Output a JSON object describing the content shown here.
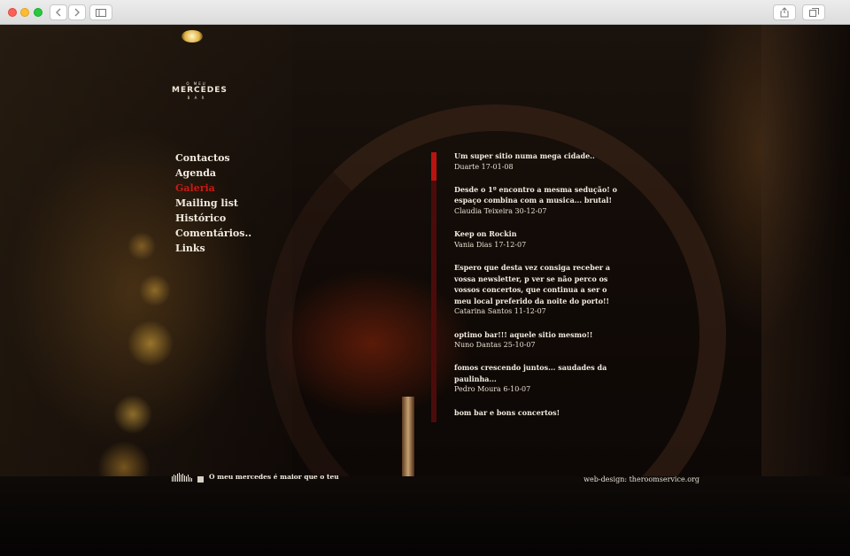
{
  "logo": {
    "top": "O MEU",
    "name": "MERCEDES",
    "sub": "B A R"
  },
  "nav": {
    "items": [
      {
        "label": "Contactos"
      },
      {
        "label": "Agenda"
      },
      {
        "label": "Galeria"
      },
      {
        "label": "Mailing list"
      },
      {
        "label": "Histórico"
      },
      {
        "label": "Comentários.."
      },
      {
        "label": "Links"
      }
    ],
    "active_index": 2,
    "active_color": "#c81a14"
  },
  "comments": [
    {
      "message": "Um super sitio numa mega cidade..",
      "author": "Duarte 17-01-08"
    },
    {
      "message": "Desde o 1º encontro a mesma sedução! o espaço combina com a musica... brutal!",
      "author": "Claudia Teixeira 30-12-07"
    },
    {
      "message": "Keep on Rockin",
      "author": "Vania Dias 17-12-07"
    },
    {
      "message": "Espero que desta vez consiga receber a vossa newsletter, p ver se não perco os vossos concertos, que continua a ser o meu local preferido da noite do porto!!",
      "author": "Catarina Santos 11-12-07"
    },
    {
      "message": "optimo bar!!! aquele sitio mesmo!!",
      "author": "Nuno Dantas 25-10-07"
    },
    {
      "message": "fomos crescendo juntos... saudades da paulinha...",
      "author": "Pedro Moura 6-10-07"
    },
    {
      "message": "bom bar e bons concertos!",
      "author": ""
    }
  ],
  "scrollbar": {
    "position": 0.1,
    "thumb_color": "#b81410",
    "track_color": "#4a0c0a"
  },
  "footer": {
    "tagline": "O meu mercedes é maior que o teu",
    "credit": "web-design: theroomservice.org"
  }
}
